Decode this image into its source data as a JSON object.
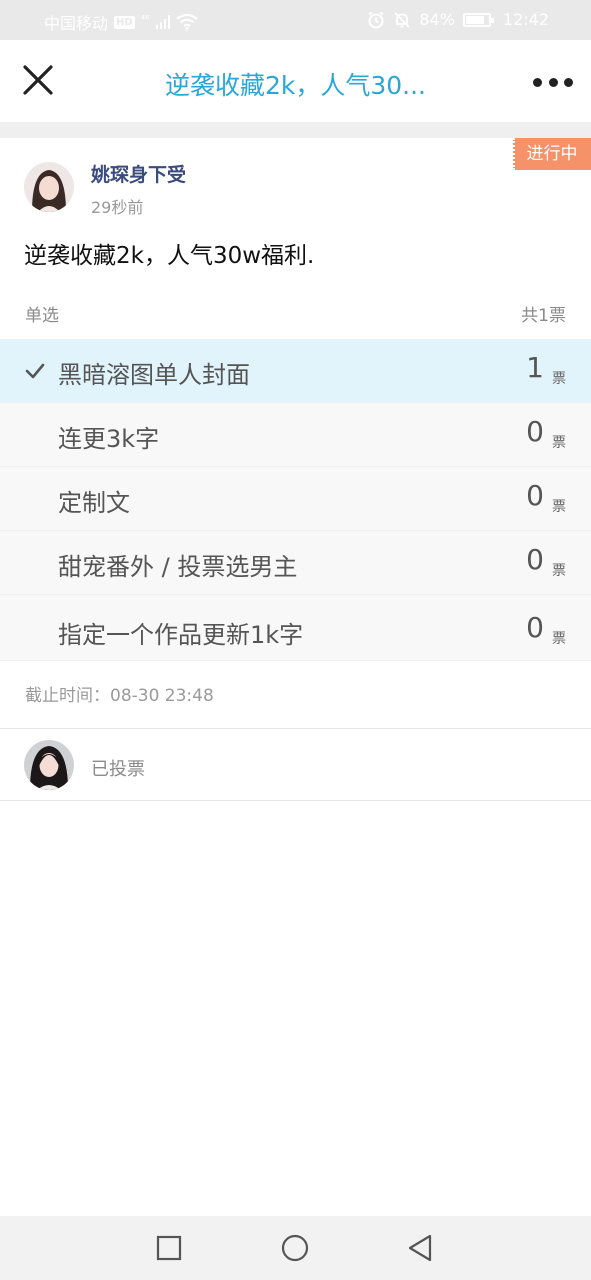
{
  "status_bar": {
    "carrier": "中国移动",
    "hd": "HD",
    "network": "⁴⁶",
    "battery_percent": "84%",
    "battery_level": 0.84,
    "time": "12:42"
  },
  "header": {
    "title": "逆袭收藏2k，人气30..."
  },
  "poll": {
    "status": "进行中",
    "author": "姚琛身下受",
    "time_ago": "29秒前",
    "question": "逆袭收藏2k，人气30w福利.",
    "type": "单选",
    "total": "共1票",
    "vote_unit": "票",
    "options": [
      {
        "label": "黑暗溶图单人封面",
        "count": "1",
        "selected": true
      },
      {
        "label": "连更3k字",
        "count": "0",
        "selected": false
      },
      {
        "label": "定制文",
        "count": "0",
        "selected": false
      },
      {
        "label": "甜宠番外 / 投票选男主",
        "count": "0",
        "selected": false
      },
      {
        "label": "指定一个作品更新1k字",
        "count": "0",
        "selected": false
      }
    ],
    "deadline": "截止时间：08-30 23:48"
  },
  "voters": {
    "status_text": "已投票"
  },
  "colors": {
    "accent": "#29a8d8",
    "status_tag": "#f6926a",
    "selected_bg": "#e1f3fb",
    "author_name": "#3a4b7c"
  },
  "icons": {
    "close": "close-icon",
    "more": "more-icon",
    "check": "check-icon",
    "nav_recent": "square-icon",
    "nav_home": "circle-icon",
    "nav_back": "triangle-back-icon"
  }
}
